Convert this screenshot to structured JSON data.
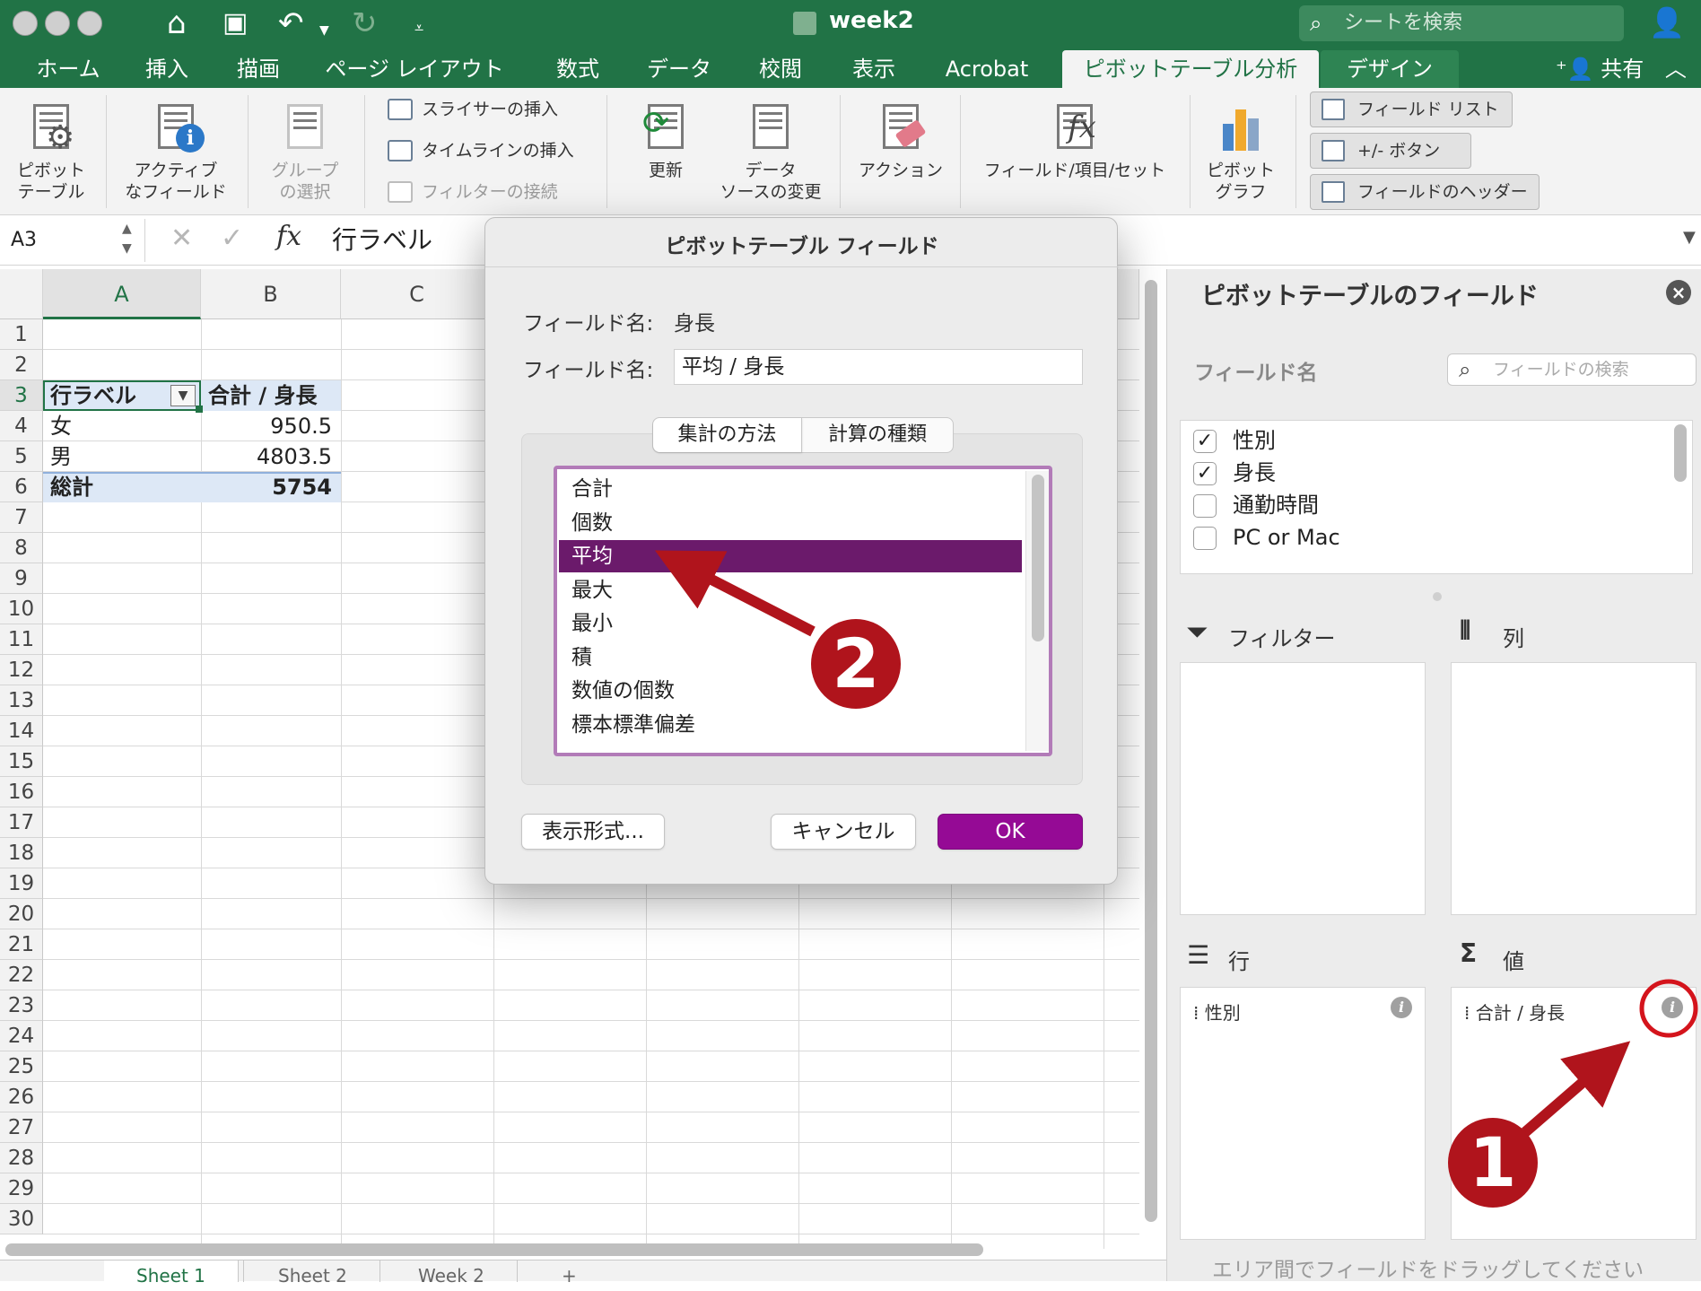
{
  "window": {
    "title": "week2",
    "search_placeholder": "シートを検索"
  },
  "tabs": [
    {
      "label": "ホーム"
    },
    {
      "label": "挿入"
    },
    {
      "label": "描画"
    },
    {
      "label": "ページ レイアウト"
    },
    {
      "label": "数式"
    },
    {
      "label": "データ"
    },
    {
      "label": "校閲"
    },
    {
      "label": "表示"
    },
    {
      "label": "Acrobat"
    },
    {
      "label": "ピボットテーブル分析"
    },
    {
      "label": "デザイン"
    }
  ],
  "share_label": "共有",
  "ribbon": {
    "pivot_table": [
      "ピボット",
      "テーブル"
    ],
    "active_field": [
      "アクティブ",
      "なフィールド"
    ],
    "group_select": [
      "グループ",
      "の選択"
    ],
    "insert_slicer": "スライサーの挿入",
    "insert_timeline": "タイムラインの挿入",
    "filter_connections": "フィルターの接続",
    "refresh": "更新",
    "change_source": [
      "データ",
      "ソースの変更"
    ],
    "actions": "アクション",
    "fields_items_sets": "フィールド/項目/セット",
    "pivot_chart": [
      "ピボット",
      "グラフ"
    ],
    "field_list": "フィールド リスト",
    "plus_minus": "+/- ボタン",
    "field_headers": "フィールドのヘッダー"
  },
  "formula_bar": {
    "name_box": "A3",
    "fx": "fx",
    "content": "行ラベル"
  },
  "sheet": {
    "columns": [
      "A",
      "B",
      "C"
    ],
    "rows": [
      "1",
      "2",
      "3",
      "4",
      "5",
      "6",
      "7",
      "8",
      "9",
      "10",
      "11",
      "12",
      "13",
      "14",
      "15",
      "16",
      "17",
      "18",
      "19",
      "20",
      "21",
      "22",
      "23",
      "24",
      "25",
      "26",
      "27",
      "28",
      "29",
      "30"
    ],
    "pivot": {
      "header_row_label": "行ラベル",
      "header_value": "合計 / 身長",
      "rows": [
        {
          "label": "女",
          "value": "950.5"
        },
        {
          "label": "男",
          "value": "4803.5"
        }
      ],
      "total_label": "総計",
      "total_value": "5754"
    },
    "tabs": [
      "Sheet 1",
      "Sheet 2",
      "Week 2",
      "+"
    ]
  },
  "dialog": {
    "title": "ピボットテーブル フィールド",
    "source_label": "フィールド名:",
    "source_value": "身長",
    "custom_label": "フィールド名:",
    "custom_value": "平均 / 身長",
    "tab_summarize": "集計の方法",
    "tab_calc": "計算の種類",
    "functions": [
      "合計",
      "個数",
      "平均",
      "最大",
      "最小",
      "積",
      "数値の個数",
      "標本標準偏差"
    ],
    "selected_function": "平均",
    "format_button": "表示形式...",
    "cancel_button": "キャンセル",
    "ok_button": "OK"
  },
  "panel": {
    "title": "ピボットテーブルのフィールド",
    "field_name_header": "フィールド名",
    "search_placeholder": "フィールドの検索",
    "fields": [
      {
        "name": "性別",
        "checked": true
      },
      {
        "name": "身長",
        "checked": true
      },
      {
        "name": "通勤時間",
        "checked": false
      },
      {
        "name": "PC or Mac",
        "checked": false
      }
    ],
    "filter_label": "フィルター",
    "columns_label": "列",
    "rows_label": "行",
    "values_label": "値",
    "rows_item": "性別",
    "values_item": "合計 / 身長",
    "hint": "エリア間でフィールドをドラッグしてください"
  },
  "annotations": {
    "step1": "1",
    "step2": "2",
    "color": "#b0141c"
  }
}
